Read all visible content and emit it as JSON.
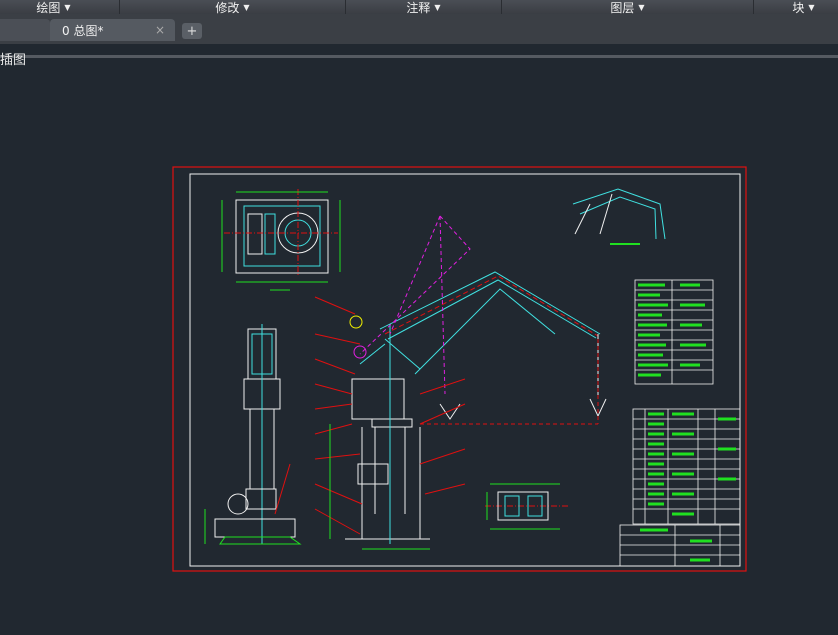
{
  "ribbon": {
    "panels": [
      {
        "label": "绘图"
      },
      {
        "label": "修改"
      },
      {
        "label": "注释"
      },
      {
        "label": "图层"
      },
      {
        "label": "块"
      }
    ]
  },
  "tabs": {
    "active_label": "0 总图*",
    "close_glyph": "×",
    "add_glyph": "+"
  },
  "viewport": {
    "label": "插图"
  },
  "colors": {
    "background": "#212830",
    "frame_red": "#e01010",
    "line_cyan": "#40e0e0",
    "line_white": "#ffffff",
    "line_green": "#20e020",
    "line_magenta": "#e020e0",
    "line_yellow": "#f0f000"
  }
}
